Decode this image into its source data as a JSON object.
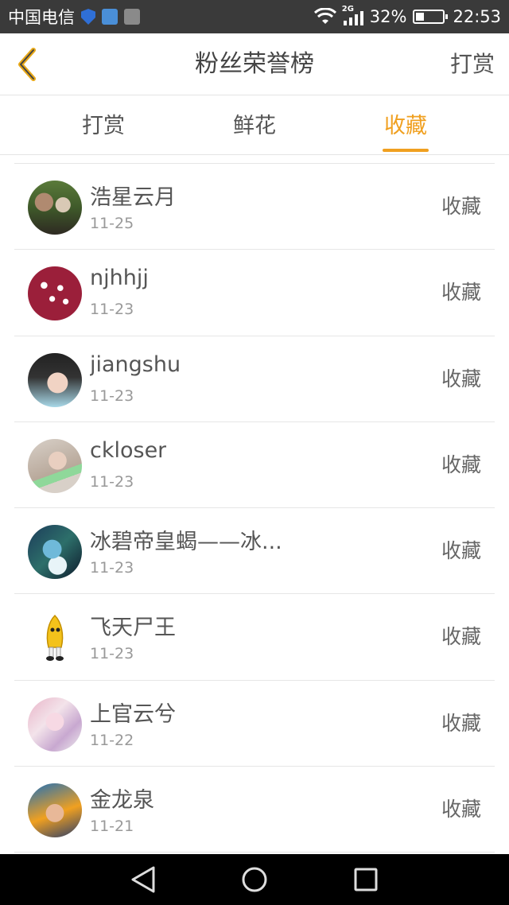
{
  "status_bar": {
    "carrier": "中国电信",
    "network": "2G",
    "battery_percent": "32%",
    "battery_level": 0.32,
    "time": "22:53"
  },
  "header": {
    "back_icon": "chevron-left-icon",
    "title": "粉丝荣誉榜",
    "right_action": "打赏"
  },
  "tabs": [
    {
      "label": "打赏",
      "active": false
    },
    {
      "label": "鲜花",
      "active": false
    },
    {
      "label": "收藏",
      "active": true
    }
  ],
  "accent_color": "#f0a020",
  "fans": [
    {
      "name": "浩星云月",
      "date": "11-25",
      "action": "收藏"
    },
    {
      "name": "njhhjj",
      "date": "11-23",
      "action": "收藏"
    },
    {
      "name": "jiangshu",
      "date": "11-23",
      "action": "收藏"
    },
    {
      "name": "ckloser",
      "date": "11-23",
      "action": "收藏"
    },
    {
      "name": "冰碧帝皇蝎——冰...",
      "date": "11-23",
      "action": "收藏"
    },
    {
      "name": "飞天尸王",
      "date": "11-23",
      "action": "收藏"
    },
    {
      "name": "上官云兮",
      "date": "11-22",
      "action": "收藏"
    },
    {
      "name": "金龙泉",
      "date": "11-21",
      "action": "收藏"
    }
  ],
  "nav": {
    "back": "back-icon",
    "home": "home-icon",
    "recents": "recents-icon"
  }
}
